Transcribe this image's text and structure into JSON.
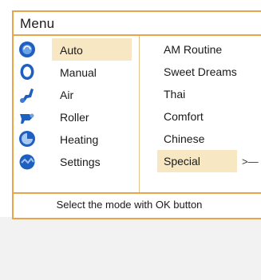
{
  "menu": {
    "title": "Menu",
    "footer": "Select the mode with OK button"
  },
  "modes": [
    {
      "label": "Auto",
      "icon": "auto-mode-icon",
      "selected": true
    },
    {
      "label": "Manual",
      "icon": "manual-mode-icon",
      "selected": false
    },
    {
      "label": "Air",
      "icon": "air-mode-icon",
      "selected": false
    },
    {
      "label": "Roller",
      "icon": "roller-mode-icon",
      "selected": false
    },
    {
      "label": "Heating",
      "icon": "heating-mode-icon",
      "selected": false
    },
    {
      "label": "Settings",
      "icon": "settings-mode-icon",
      "selected": false
    }
  ],
  "programs": [
    {
      "label": "AM Routine",
      "selected": false
    },
    {
      "label": "Sweet Dreams",
      "selected": false
    },
    {
      "label": "Thai",
      "selected": false
    },
    {
      "label": "Comfort",
      "selected": false
    },
    {
      "label": "Chinese",
      "selected": false
    },
    {
      "label": "Special",
      "selected": true
    }
  ],
  "selection_arrow": ">—",
  "colors": {
    "accent_border": "#e8a54a",
    "selection_highlight": "#f7e7c2",
    "icon_blue": "#1e5fbf"
  }
}
